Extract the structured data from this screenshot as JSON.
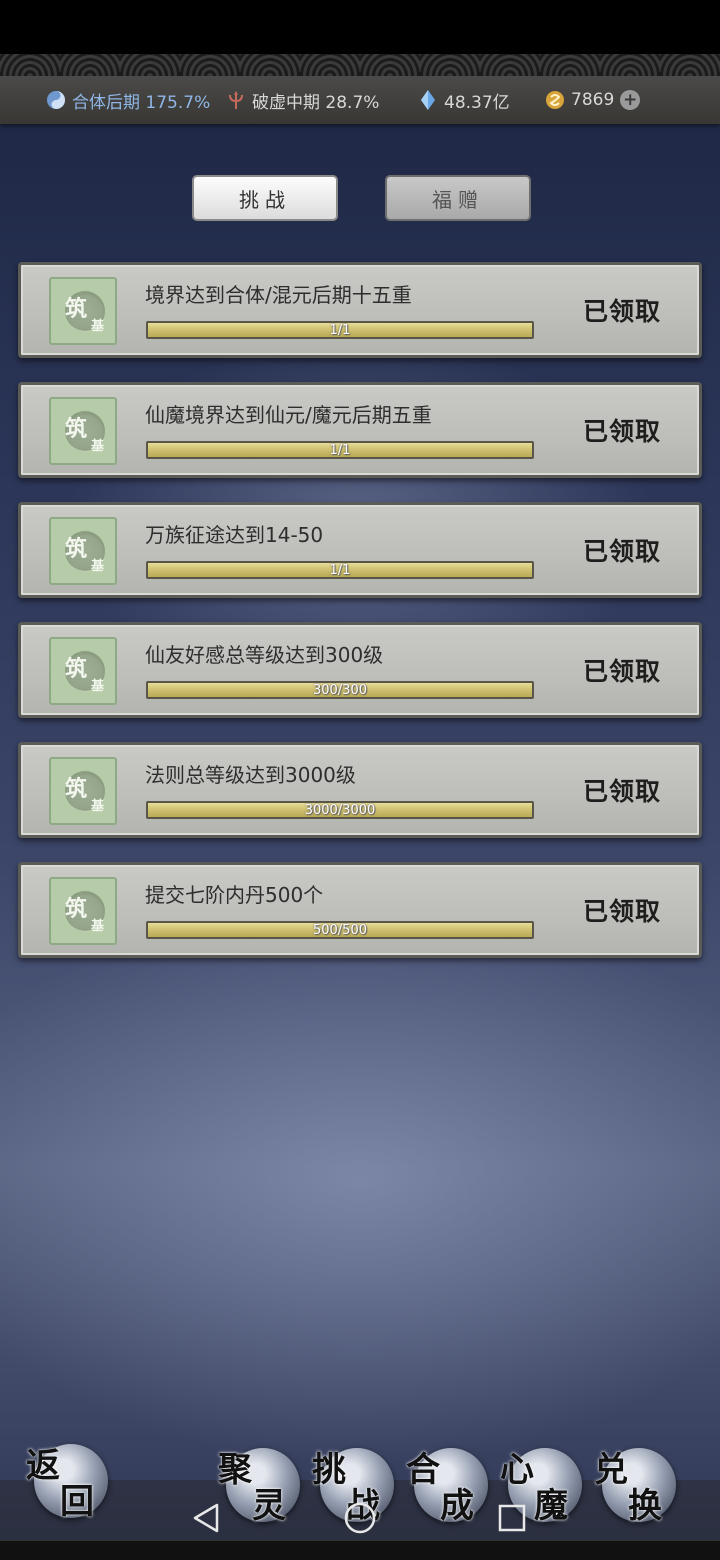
{
  "resources": {
    "realm_label": "合体后期 175.7%",
    "break_label": "破虚中期 28.7%",
    "crystal_value": "48.37亿",
    "gold_value": "7869"
  },
  "tabs": [
    {
      "label": "挑战",
      "active": true
    },
    {
      "label": "福赠",
      "active": false
    }
  ],
  "tasks": [
    {
      "title": "境界达到合体/混元后期十五重",
      "progress_text": "1/1",
      "progress_fraction": 1.0,
      "status": "已领取"
    },
    {
      "title": "仙魔境界达到仙元/魔元后期五重",
      "progress_text": "1/1",
      "progress_fraction": 1.0,
      "status": "已领取"
    },
    {
      "title": "万族征途达到14-50",
      "progress_text": "1/1",
      "progress_fraction": 1.0,
      "status": "已领取"
    },
    {
      "title": "仙友好感总等级达到300级",
      "progress_text": "300/300",
      "progress_fraction": 1.0,
      "status": "已领取"
    },
    {
      "title": "法则总等级达到3000级",
      "progress_text": "3000/3000",
      "progress_fraction": 1.0,
      "status": "已领取"
    },
    {
      "title": "提交七阶内丹500个",
      "progress_text": "500/500",
      "progress_fraction": 1.0,
      "status": "已领取"
    }
  ],
  "task_icon": {
    "char1": "筑",
    "char2": "基"
  },
  "bottom_nav": [
    {
      "c1": "返",
      "c2": "回"
    },
    {
      "c1": "聚",
      "c2": "灵"
    },
    {
      "c1": "挑",
      "c2": "战"
    },
    {
      "c1": "合",
      "c2": "成"
    },
    {
      "c1": "心",
      "c2": "魔"
    },
    {
      "c1": "兑",
      "c2": "换"
    }
  ],
  "colors": {
    "accent_blue": "#8fb6e6",
    "card_bg": "#c2c2be",
    "progress_gold": "#cdbf6e"
  }
}
